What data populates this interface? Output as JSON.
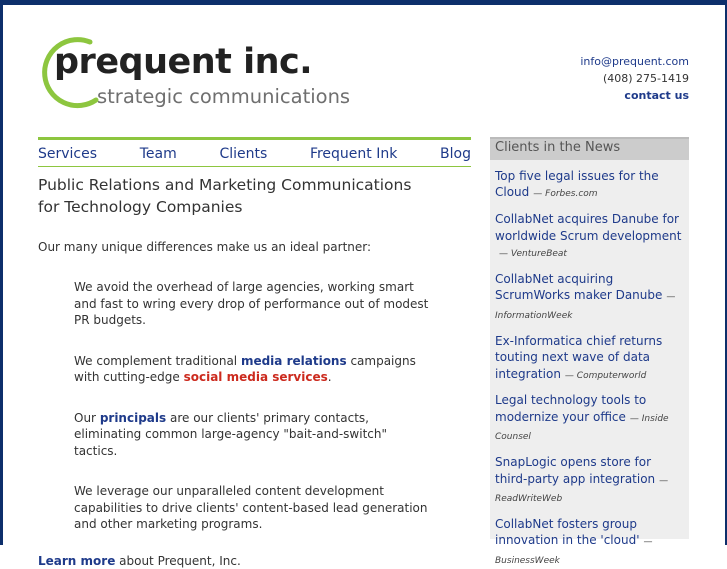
{
  "brand": {
    "name": "prequent inc.",
    "tagline": "strategic communications",
    "accent": "#8dc63f",
    "frame": "#0d2f6b"
  },
  "contact": {
    "email": "info@prequent.com",
    "phone": "(408) 275-1419",
    "cta": "contact us"
  },
  "nav": {
    "items": [
      "Services",
      "Team",
      "Clients",
      "Frequent Ink",
      "Blog"
    ]
  },
  "main": {
    "heading_line1": "Public Relations and Marketing Communications",
    "heading_line2": "for Technology Companies",
    "intro": "Our many unique differences make us an ideal partner:",
    "point1": "We avoid the overhead of large agencies, working smart and fast to wring every drop of performance out of modest PR budgets.",
    "point2_a": "We complement traditional ",
    "point2_kw1": "media relations",
    "point2_b": " campaigns with cutting-edge ",
    "point2_kw2": "social media services",
    "point2_c": ".",
    "point3_a": "Our ",
    "point3_kw": "principals",
    "point3_b": " are our clients' primary contacts, eliminating common large-agency \"bait-and-switch\" tactics.",
    "point4": "We leverage our unparalleled content development capabilities to drive clients' content-based lead generation and other marketing programs.",
    "learn_link": "Learn more",
    "learn_rest": " about Prequent, Inc."
  },
  "news": {
    "heading": "Clients in the News",
    "items": [
      {
        "title": "Top five legal issues for the Cloud",
        "source": "— Forbes.com"
      },
      {
        "title": "CollabNet acquires Danube for worldwide Scrum development",
        "source": "— VentureBeat"
      },
      {
        "title": "CollabNet acquiring ScrumWorks maker Danube",
        "source": "— InformationWeek"
      },
      {
        "title": "Ex-Informatica chief returns touting next wave of data integration",
        "source": "— Computerworld"
      },
      {
        "title": "Legal technology tools to modernize your office",
        "source": "— Inside Counsel"
      },
      {
        "title": "SnapLogic opens store for third-party app integration",
        "source": "— ReadWriteWeb"
      },
      {
        "title": "CollabNet fosters group innovation in the 'cloud'",
        "source": "— BusinessWeek"
      }
    ]
  }
}
